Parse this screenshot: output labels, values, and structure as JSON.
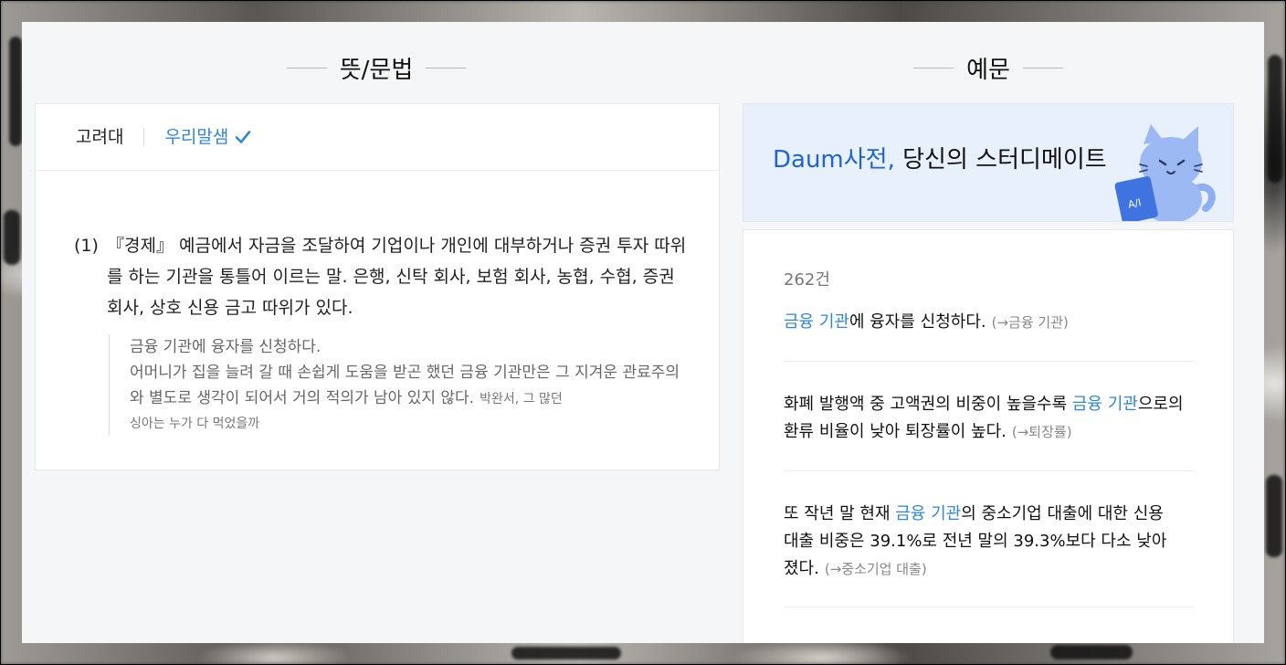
{
  "left_section": {
    "title": "뜻/문법",
    "tabs": [
      {
        "label": "고려대"
      },
      {
        "label": "우리말샘"
      }
    ],
    "definition": {
      "number": "(1)",
      "text": "『경제』 예금에서 자금을 조달하여 기업이나 개인에 대부하거나 증권 투자 따위를 하는 기관을 통틀어 이르는 말. 은행, 신탁 회사, 보험 회사, 농협, 수협, 증권 회사, 상호 신용 금고 따위가 있다.",
      "examples": [
        {
          "text": "금융 기관에 융자를 신청하다."
        },
        {
          "text": "어머니가 집을 늘려 갈 때 손쉽게 도움을 받곤 했던 금융 기관만은 그 지겨운 관료주의와 별도로 생각이 되어서 거의 적의가 남아 있지 않다.",
          "source_a": "박완서, 그 많던",
          "source_b": "싱아는 누가 다 먹었을까"
        }
      ]
    }
  },
  "right_section": {
    "title": "예문",
    "banner": {
      "brand": "Daum사전,",
      "slogan": " 당신의 스터디메이트"
    },
    "count": "262건",
    "examples": [
      {
        "before": "",
        "highlight": "금융 기관",
        "after": "에 융자를 신청하다.",
        "ref": "(→금융 기관)"
      },
      {
        "before": "화폐 발행액 중 고액권의 비중이 높을수록 ",
        "highlight": "금융 기관",
        "after": "으로의 환류 비율이 낮아 퇴장률이 높다.",
        "ref": "(→퇴장률)"
      },
      {
        "before": "또 작년 말 현재 ",
        "highlight": "금융 기관",
        "after": "의 중소기업 대출에 대한 신용 대출 비중은 39.1%로 전년 말의 39.3%보다 다소 낮아졌다.",
        "ref": "(→중소기업 대출)"
      }
    ]
  },
  "colors": {
    "accent": "#2e86de",
    "brand": "#1e63d6",
    "panel": "#f5f6f8"
  }
}
